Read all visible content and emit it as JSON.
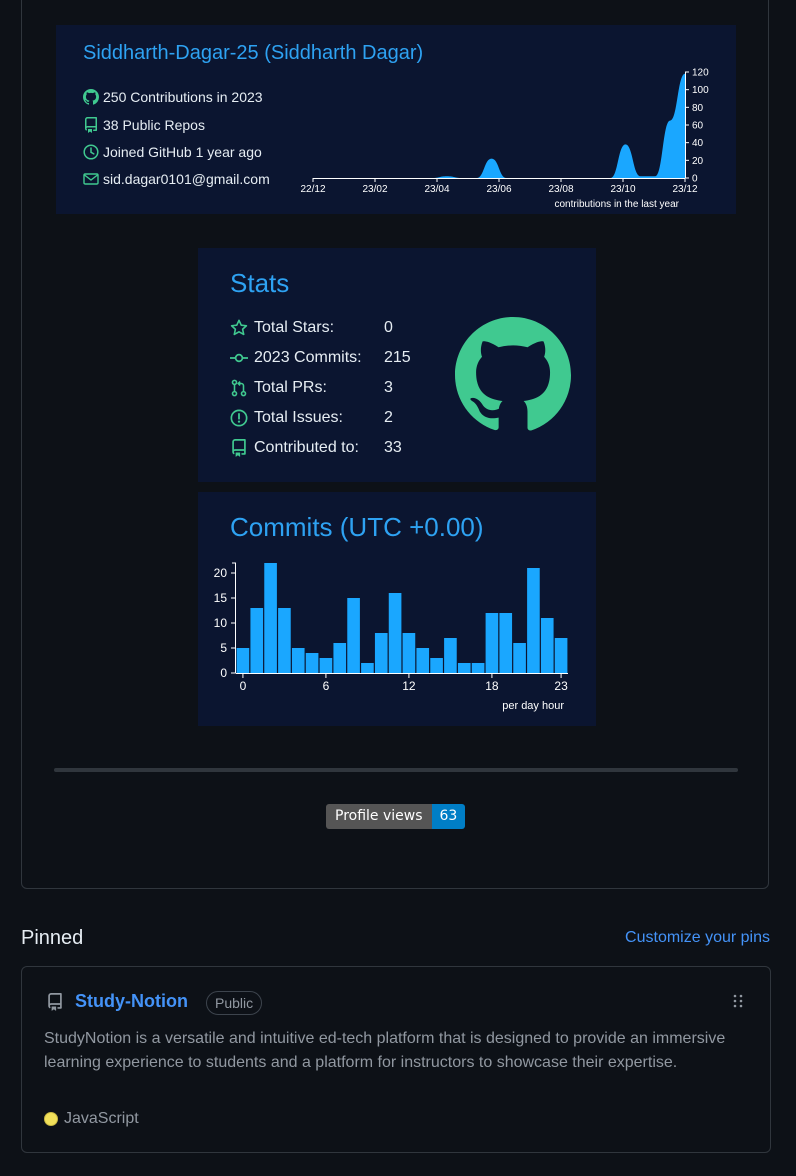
{
  "profile": {
    "title": "Siddharth-Dagar-25 (Siddharth Dagar)",
    "contributions": "250 Contributions in 2023",
    "repos": "38 Public Repos",
    "joined": "Joined GitHub 1 year ago",
    "email": "sid.dagar0101@gmail.com",
    "icons": [
      "github-icon",
      "repo-icon",
      "clock-icon",
      "mail-icon"
    ]
  },
  "stats": {
    "title": "Stats",
    "rows": [
      {
        "label": "Total Stars:",
        "value": "0",
        "icon": "star-icon"
      },
      {
        "label": "2023 Commits:",
        "value": "215",
        "icon": "commit-icon"
      },
      {
        "label": "Total PRs:",
        "value": "3",
        "icon": "pull-request-icon"
      },
      {
        "label": "Total Issues:",
        "value": "2",
        "icon": "issue-icon"
      },
      {
        "label": "Contributed to:",
        "value": "33",
        "icon": "repo-icon"
      }
    ],
    "accent": "#2ea2f2",
    "icon_color": "#40c990"
  },
  "commits": {
    "title": "Commits (UTC +0.00)"
  },
  "chart_data": [
    {
      "type": "area",
      "xlabel": "contributions in the last year",
      "x": [
        "22/12",
        "23/02",
        "23/04",
        "23/06",
        "23/08",
        "23/10",
        "23/12"
      ],
      "ylim": [
        0,
        120
      ],
      "yticks": [
        0,
        20,
        40,
        60,
        80,
        100,
        120
      ],
      "series": [
        {
          "values": [
            0,
            0,
            0,
            0,
            0,
            0,
            0,
            0,
            0,
            2,
            0,
            0,
            22,
            0,
            0,
            0,
            0,
            0,
            0,
            0,
            0,
            38,
            2,
            2,
            65,
            118
          ]
        }
      ],
      "color": "#1aa7ff"
    },
    {
      "type": "bar",
      "xlabel": "per day hour",
      "categories": [
        0,
        1,
        2,
        3,
        4,
        5,
        6,
        7,
        8,
        9,
        10,
        11,
        12,
        13,
        14,
        15,
        16,
        17,
        18,
        19,
        20,
        21,
        22,
        23
      ],
      "xticks": [
        0,
        6,
        12,
        18,
        23
      ],
      "values": [
        5,
        13,
        22,
        13,
        5,
        4,
        3,
        6,
        15,
        2,
        8,
        16,
        8,
        5,
        3,
        7,
        2,
        2,
        12,
        12,
        6,
        21,
        11,
        7
      ],
      "ylim": [
        0,
        22
      ],
      "yticks": [
        0,
        5,
        10,
        15,
        20
      ],
      "color": "#1aa7ff"
    }
  ],
  "badge": {
    "label": "Profile views",
    "count": "63"
  },
  "pinned": {
    "heading": "Pinned",
    "customize": "Customize your pins",
    "repo": {
      "name": "Study-Notion",
      "visibility": "Public",
      "description": "StudyNotion is a versatile and intuitive ed-tech platform that is designed to provide an immersive learning experience to students and a platform for instructors to showcase their expertise.",
      "language": "JavaScript",
      "language_color": "#f1e05a"
    }
  }
}
